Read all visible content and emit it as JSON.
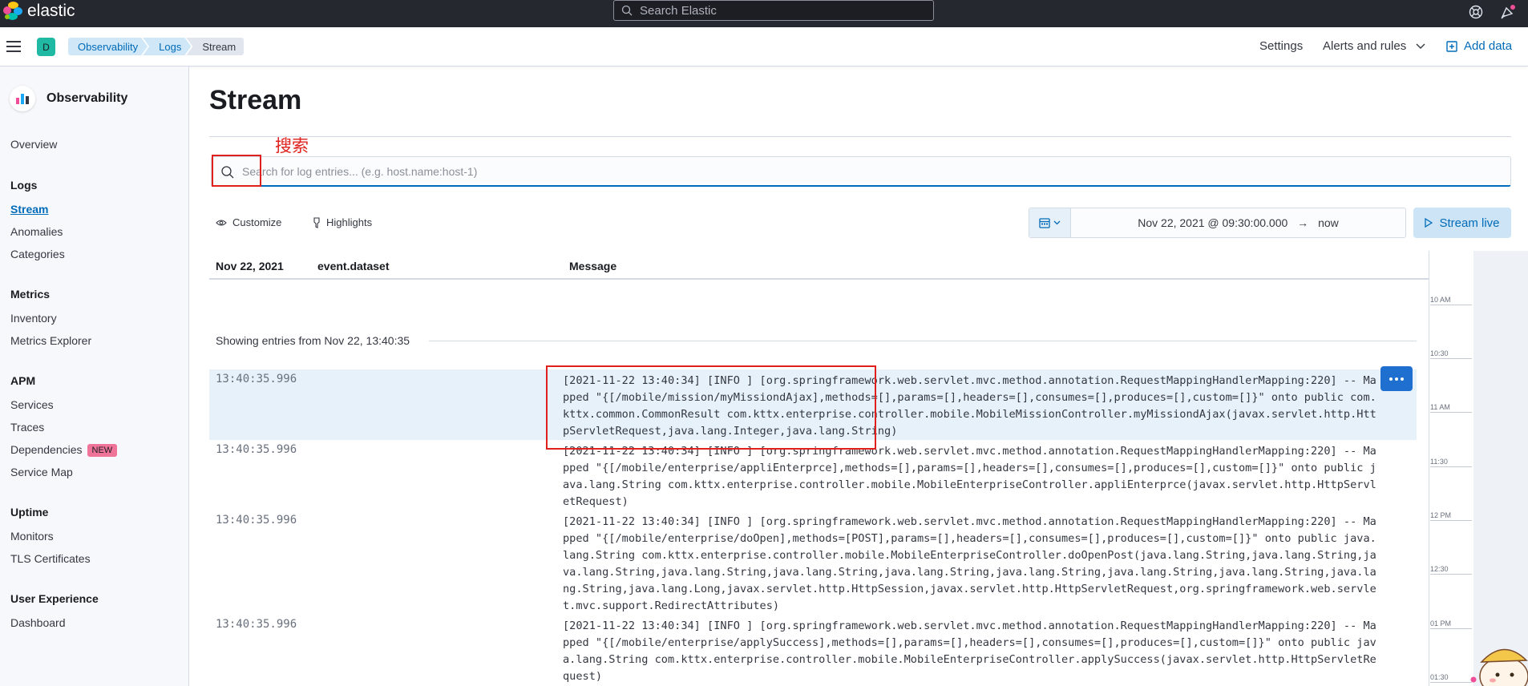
{
  "topbar": {
    "logo_text": "elastic",
    "search_placeholder": "Search Elastic",
    "icons": [
      "help-icon",
      "newsfeed-icon"
    ]
  },
  "header": {
    "space_initial": "D",
    "breadcrumbs": [
      "Observability",
      "Logs",
      "Stream"
    ],
    "settings_label": "Settings",
    "alerts_label": "Alerts and rules",
    "add_data_label": "Add data"
  },
  "sidebar": {
    "title": "Observability",
    "overview": "Overview",
    "sections": [
      {
        "heading": "Logs",
        "items": [
          "Stream",
          "Anomalies",
          "Categories"
        ]
      },
      {
        "heading": "Metrics",
        "items": [
          "Inventory",
          "Metrics Explorer"
        ]
      },
      {
        "heading": "APM",
        "items": [
          "Services",
          "Traces",
          "Dependencies",
          "Service Map"
        ]
      },
      {
        "heading": "Uptime",
        "items": [
          "Monitors",
          "TLS Certificates"
        ]
      },
      {
        "heading": "User Experience",
        "items": [
          "Dashboard"
        ]
      }
    ],
    "new_badge": "NEW",
    "active_item": "Stream"
  },
  "main": {
    "title": "Stream",
    "annotation_label": "搜索",
    "log_search_placeholder": "Search for log entries... (e.g. host.name:host-1)",
    "customize_label": "Customize",
    "highlights_label": "Highlights",
    "date_start": "Nov 22, 2021 @ 09:30:00.000",
    "date_arrow": "→",
    "date_end": "now",
    "stream_live_label": "Stream live",
    "columns": [
      "Nov 22, 2021",
      "event.dataset",
      "Message"
    ],
    "showing_text": "Showing entries from Nov 22, 13:40:35",
    "rows": [
      {
        "time": "13:40:35.996",
        "message": "[2021-11-22 13:40:34] [INFO ] [org.springframework.web.servlet.mvc.method.annotation.RequestMappingHandlerMapping:220] -- Mapped \"{[/mobile/mission/myMissiondAjax],methods=[],params=[],headers=[],consumes=[],produces=[],custom=[]}\" onto public com.kttx.common.CommonResult com.kttx.enterprise.controller.mobile.MobileMissionController.myMissiondAjax(javax.servlet.http.HttpServletRequest,java.lang.Integer,java.lang.String)"
      },
      {
        "time": "13:40:35.996",
        "message": "[2021-11-22 13:40:34] [INFO ] [org.springframework.web.servlet.mvc.method.annotation.RequestMappingHandlerMapping:220] -- Mapped \"{[/mobile/enterprise/appliEnterprce],methods=[],params=[],headers=[],consumes=[],produces=[],custom=[]}\" onto public java.lang.String com.kttx.enterprise.controller.mobile.MobileEnterpriseController.appliEnterprce(javax.servlet.http.HttpServletRequest)"
      },
      {
        "time": "13:40:35.996",
        "message": "[2021-11-22 13:40:34] [INFO ] [org.springframework.web.servlet.mvc.method.annotation.RequestMappingHandlerMapping:220] -- Mapped \"{[/mobile/enterprise/doOpen],methods=[POST],params=[],headers=[],consumes=[],produces=[],custom=[]}\" onto public java.lang.String com.kttx.enterprise.controller.mobile.MobileEnterpriseController.doOpenPost(java.lang.String,java.lang.String,java.lang.String,java.lang.String,java.lang.String,java.lang.String,java.lang.String,java.lang.String,java.lang.String,java.lang.String,java.lang.Long,javax.servlet.http.HttpSession,javax.servlet.http.HttpServletRequest,org.springframework.web.servlet.mvc.support.RedirectAttributes)"
      },
      {
        "time": "13:40:35.996",
        "message": "[2021-11-22 13:40:34] [INFO ] [org.springframework.web.servlet.mvc.method.annotation.RequestMappingHandlerMapping:220] -- Mapped \"{[/mobile/enterprise/applySuccess],methods=[],params=[],headers=[],consumes=[],produces=[],custom=[]}\" onto public java.lang.String com.kttx.enterprise.controller.mobile.MobileEnterpriseController.applySuccess(javax.servlet.http.HttpServletRequest)"
      }
    ],
    "minimap_ticks": [
      "10 AM",
      "10:30",
      "11 AM",
      "11:30",
      "12 PM",
      "12:30",
      "01 PM",
      "01:30"
    ]
  },
  "colors": {
    "accent": "#006bb8",
    "annotation": "#e0201c",
    "topbar": "#25282f",
    "highlight_row": "#e6f1fa"
  }
}
